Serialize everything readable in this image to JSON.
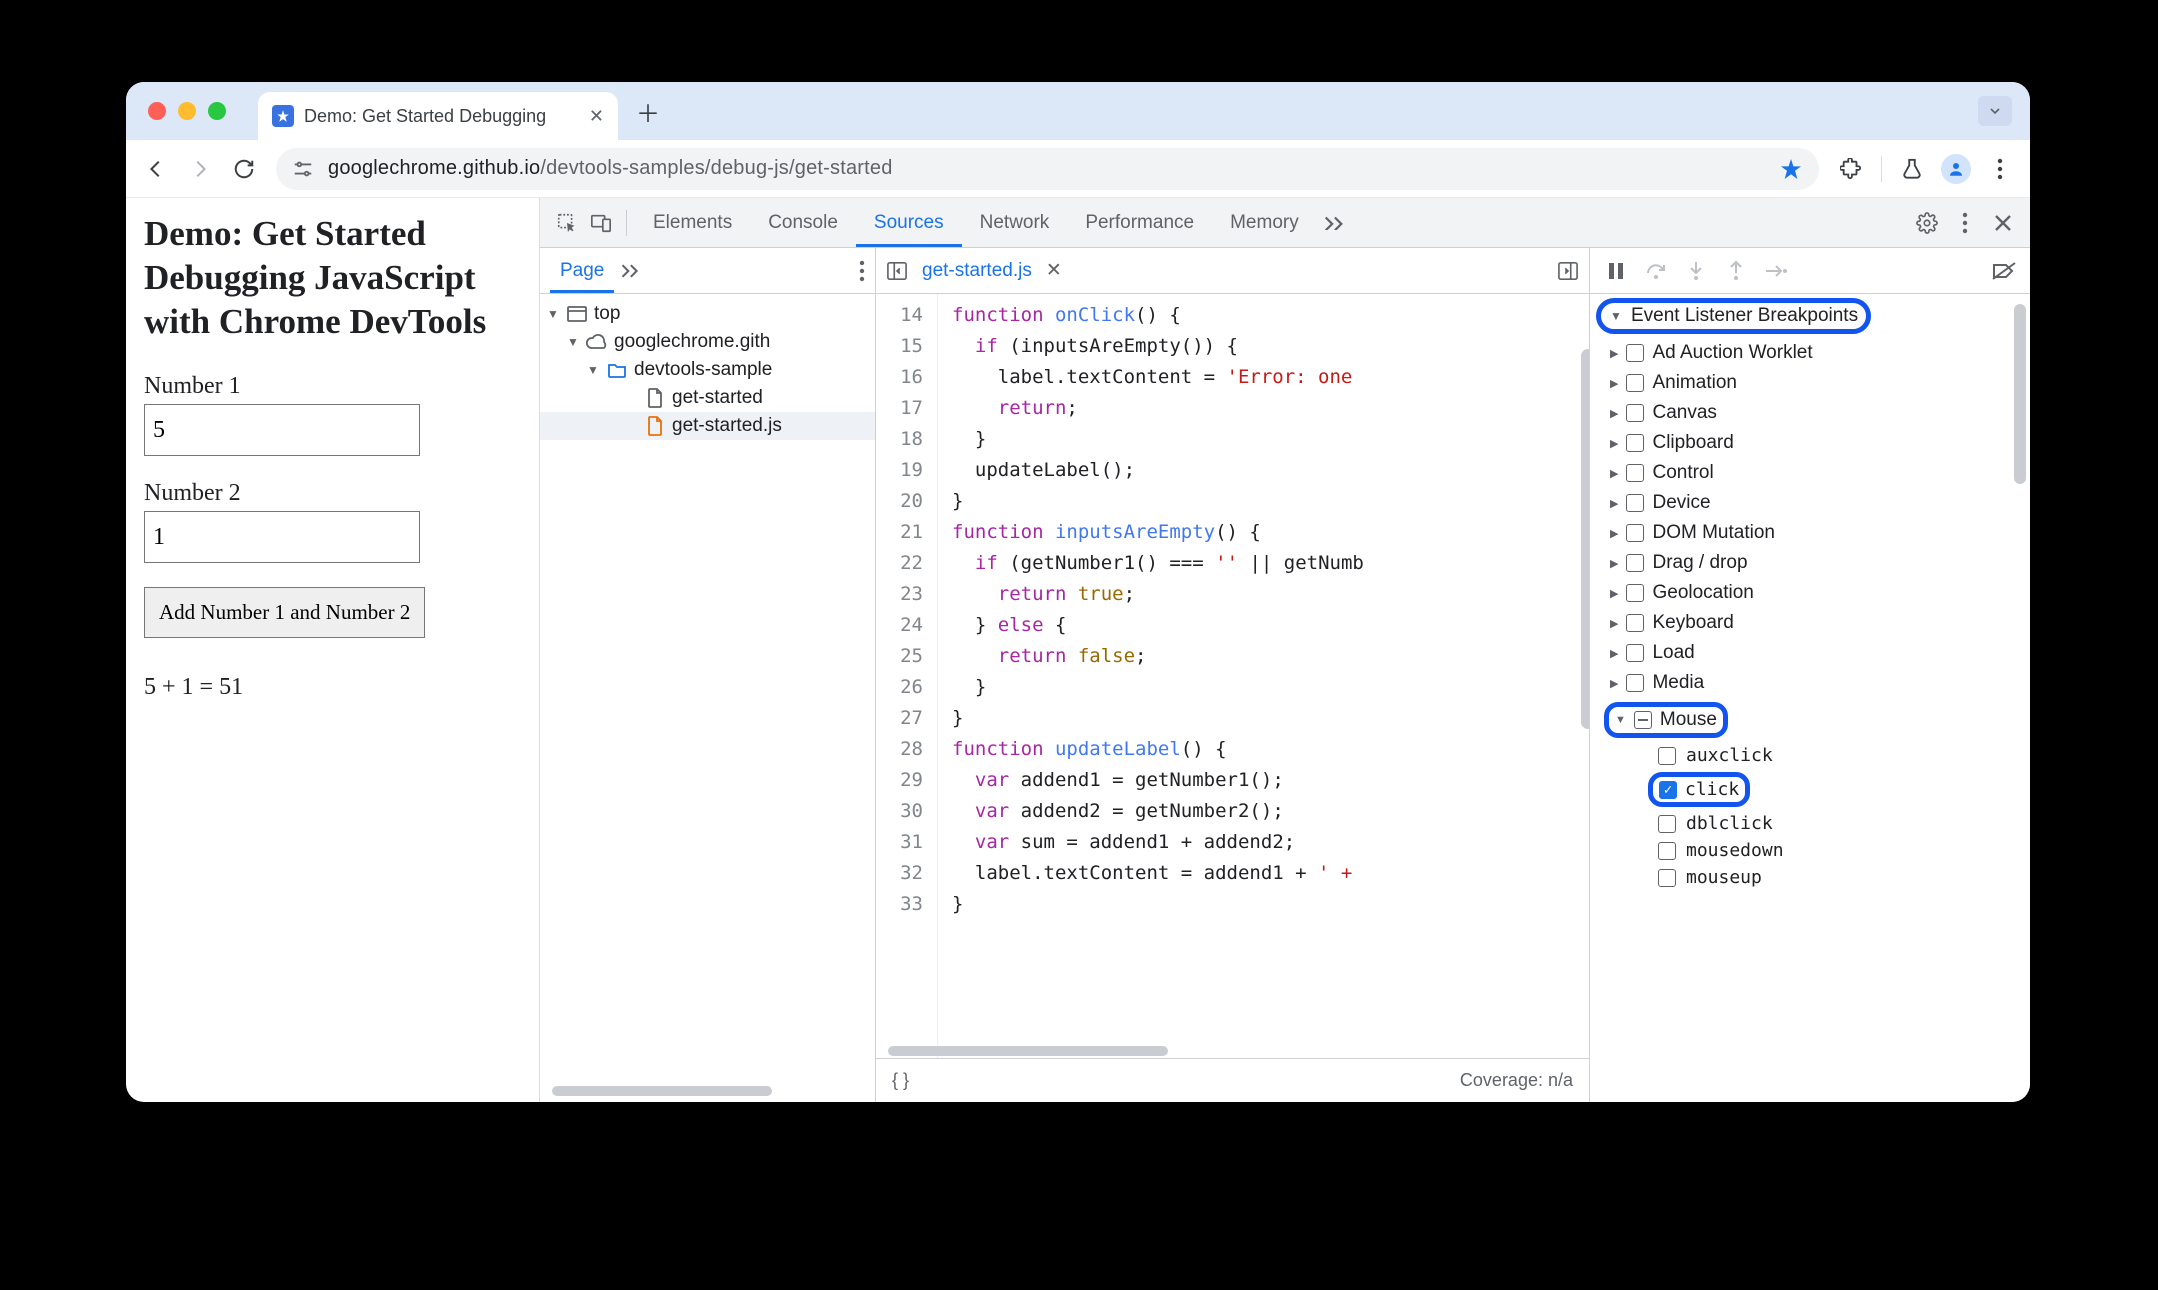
{
  "tab": {
    "title": "Demo: Get Started Debugging"
  },
  "omnibox": {
    "host": "googlechrome.github.io",
    "path": "/devtools-samples/debug-js/get-started"
  },
  "page": {
    "heading": "Demo: Get Started Debugging JavaScript with Chrome DevTools",
    "num1_label": "Number 1",
    "num1_value": "5",
    "num2_label": "Number 2",
    "num2_value": "1",
    "button_label": "Add Number 1 and Number 2",
    "result": "5 + 1 = 51"
  },
  "devtools": {
    "tabs": [
      "Elements",
      "Console",
      "Sources",
      "Network",
      "Performance",
      "Memory"
    ],
    "active_tab": "Sources",
    "navigator": {
      "subtab": "Page",
      "tree": [
        {
          "label": "top",
          "icon": "window",
          "depth": 0,
          "open": true
        },
        {
          "label": "googlechrome.gith",
          "icon": "cloud",
          "depth": 1,
          "open": true
        },
        {
          "label": "devtools-sample",
          "icon": "folder",
          "depth": 2,
          "open": true
        },
        {
          "label": "get-started",
          "icon": "file",
          "depth": 3,
          "open": false
        },
        {
          "label": "get-started.js",
          "icon": "jsfile",
          "depth": 3,
          "open": false,
          "selected": true
        }
      ]
    },
    "editor": {
      "filename": "get-started.js",
      "first_line": 14,
      "lines": [
        [
          [
            "kw",
            "function "
          ],
          [
            "fn",
            "onClick"
          ],
          [
            "op",
            "() {"
          ]
        ],
        [
          [
            "op",
            "  "
          ],
          [
            "kw",
            "if "
          ],
          [
            "op",
            "(inputsAreEmpty()) {"
          ]
        ],
        [
          [
            "op",
            "    label.textContent = "
          ],
          [
            "str",
            "'Error: one"
          ]
        ],
        [
          [
            "op",
            "    "
          ],
          [
            "kw",
            "return"
          ],
          [
            "op",
            ";"
          ]
        ],
        [
          [
            "op",
            "  }"
          ]
        ],
        [
          [
            "op",
            "  updateLabel();"
          ]
        ],
        [
          [
            "op",
            "}"
          ]
        ],
        [
          [
            "kw",
            "function "
          ],
          [
            "fn",
            "inputsAreEmpty"
          ],
          [
            "op",
            "() {"
          ]
        ],
        [
          [
            "op",
            "  "
          ],
          [
            "kw",
            "if "
          ],
          [
            "op",
            "(getNumber1() === "
          ],
          [
            "str",
            "''"
          ],
          [
            "op",
            " || getNumb"
          ]
        ],
        [
          [
            "op",
            "    "
          ],
          [
            "kw",
            "return "
          ],
          [
            "var2",
            "true"
          ],
          [
            "op",
            ";"
          ]
        ],
        [
          [
            "op",
            "  } "
          ],
          [
            "kw",
            "else "
          ],
          [
            "op",
            "{"
          ]
        ],
        [
          [
            "op",
            "    "
          ],
          [
            "kw",
            "return "
          ],
          [
            "var2",
            "false"
          ],
          [
            "op",
            ";"
          ]
        ],
        [
          [
            "op",
            "  }"
          ]
        ],
        [
          [
            "op",
            "}"
          ]
        ],
        [
          [
            "kw",
            "function "
          ],
          [
            "fn",
            "updateLabel"
          ],
          [
            "op",
            "() {"
          ]
        ],
        [
          [
            "op",
            "  "
          ],
          [
            "kw",
            "var "
          ],
          [
            "op",
            "addend1 = getNumber1();"
          ]
        ],
        [
          [
            "op",
            "  "
          ],
          [
            "kw",
            "var "
          ],
          [
            "op",
            "addend2 = getNumber2();"
          ]
        ],
        [
          [
            "op",
            "  "
          ],
          [
            "kw",
            "var "
          ],
          [
            "op",
            "sum = addend1 + addend2;"
          ]
        ],
        [
          [
            "op",
            "  label.textContent = addend1 + "
          ],
          [
            "str",
            "' +"
          ]
        ],
        [
          [
            "op",
            "}"
          ]
        ]
      ],
      "coverage": "Coverage: n/a"
    },
    "debugger": {
      "section": "Event Listener Breakpoints",
      "categories": [
        {
          "name": "Ad Auction Worklet"
        },
        {
          "name": "Animation"
        },
        {
          "name": "Canvas"
        },
        {
          "name": "Clipboard"
        },
        {
          "name": "Control"
        },
        {
          "name": "Device"
        },
        {
          "name": "DOM Mutation"
        },
        {
          "name": "Drag / drop"
        },
        {
          "name": "Geolocation"
        },
        {
          "name": "Keyboard"
        },
        {
          "name": "Load"
        },
        {
          "name": "Media"
        },
        {
          "name": "Mouse",
          "expanded": true,
          "indet": true,
          "highlight": true,
          "events": [
            {
              "name": "auxclick",
              "checked": false
            },
            {
              "name": "click",
              "checked": true,
              "highlight": true
            },
            {
              "name": "dblclick",
              "checked": false
            },
            {
              "name": "mousedown",
              "checked": false
            },
            {
              "name": "mouseup",
              "checked": false
            }
          ]
        }
      ]
    }
  }
}
